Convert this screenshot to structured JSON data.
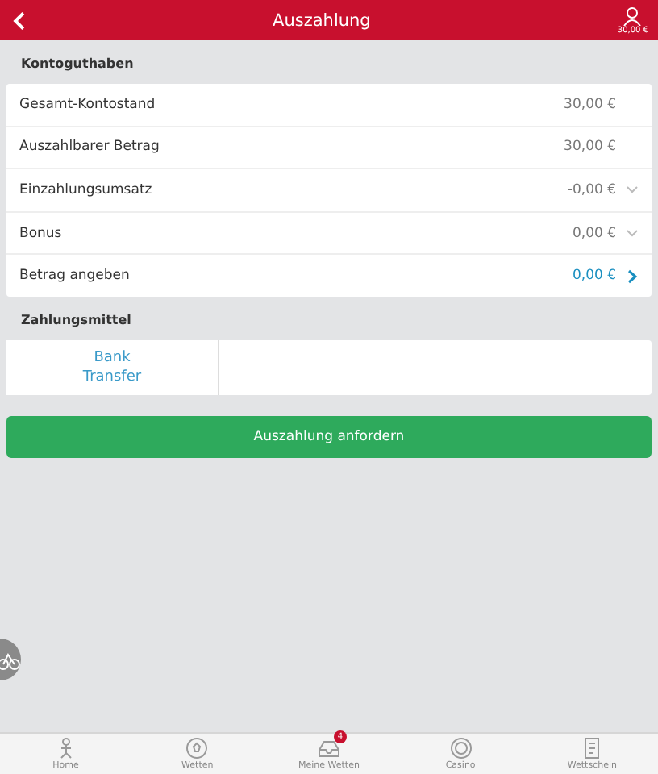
{
  "header": {
    "title": "Auszahlung",
    "balance": "30,00 €"
  },
  "balance_section": {
    "title": "Kontoguthaben",
    "rows": [
      {
        "label": "Gesamt-Kontostand",
        "value": "30,00 €",
        "kind": "plain"
      },
      {
        "label": "Auszahlbarer Betrag",
        "value": "30,00 €",
        "kind": "plain"
      },
      {
        "label": "Einzahlungsumsatz",
        "value": "-0,00 €",
        "kind": "expand"
      },
      {
        "label": "Bonus",
        "value": "0,00 €",
        "kind": "expand"
      },
      {
        "label": "Betrag angeben",
        "value": "0,00 €",
        "kind": "action"
      }
    ]
  },
  "payment_section": {
    "title": "Zahlungsmittel",
    "methods": [
      {
        "label": "Bank Transfer",
        "selected": true
      }
    ]
  },
  "submit_button": "Auszahlung anfordern",
  "bottom_nav": [
    {
      "label": "Home",
      "kind": "home"
    },
    {
      "label": "Wetten",
      "kind": "ball"
    },
    {
      "label": "Meine Wetten",
      "kind": "inbox",
      "badge": "4"
    },
    {
      "label": "Casino",
      "kind": "chip"
    },
    {
      "label": "Wettschein",
      "kind": "slip"
    }
  ]
}
